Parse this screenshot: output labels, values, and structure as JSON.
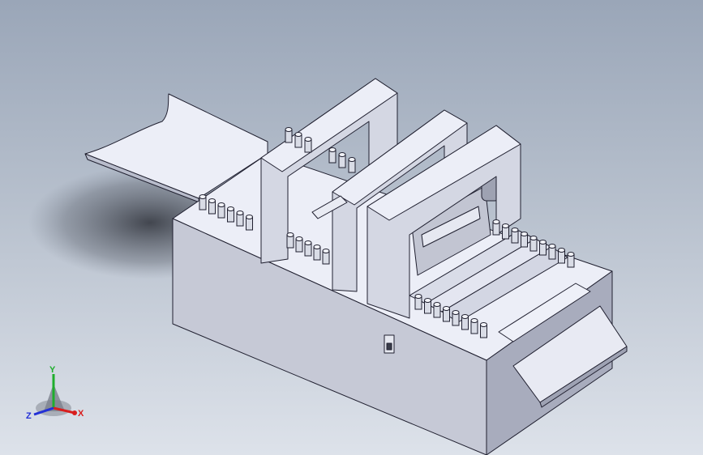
{
  "viewport": {
    "background_top": "#9aa6b8",
    "background_bottom": "#dde2ea"
  },
  "model": {
    "body_colors": {
      "top": "#eceef7",
      "front": "#c9ccd9",
      "side": "#a8acbd",
      "edge": "#202030"
    }
  },
  "triad": {
    "x_label": "X",
    "y_label": "Y",
    "z_label": "Z",
    "x_color": "#d81e1e",
    "y_color": "#1fae2d",
    "z_color": "#2330d6"
  }
}
